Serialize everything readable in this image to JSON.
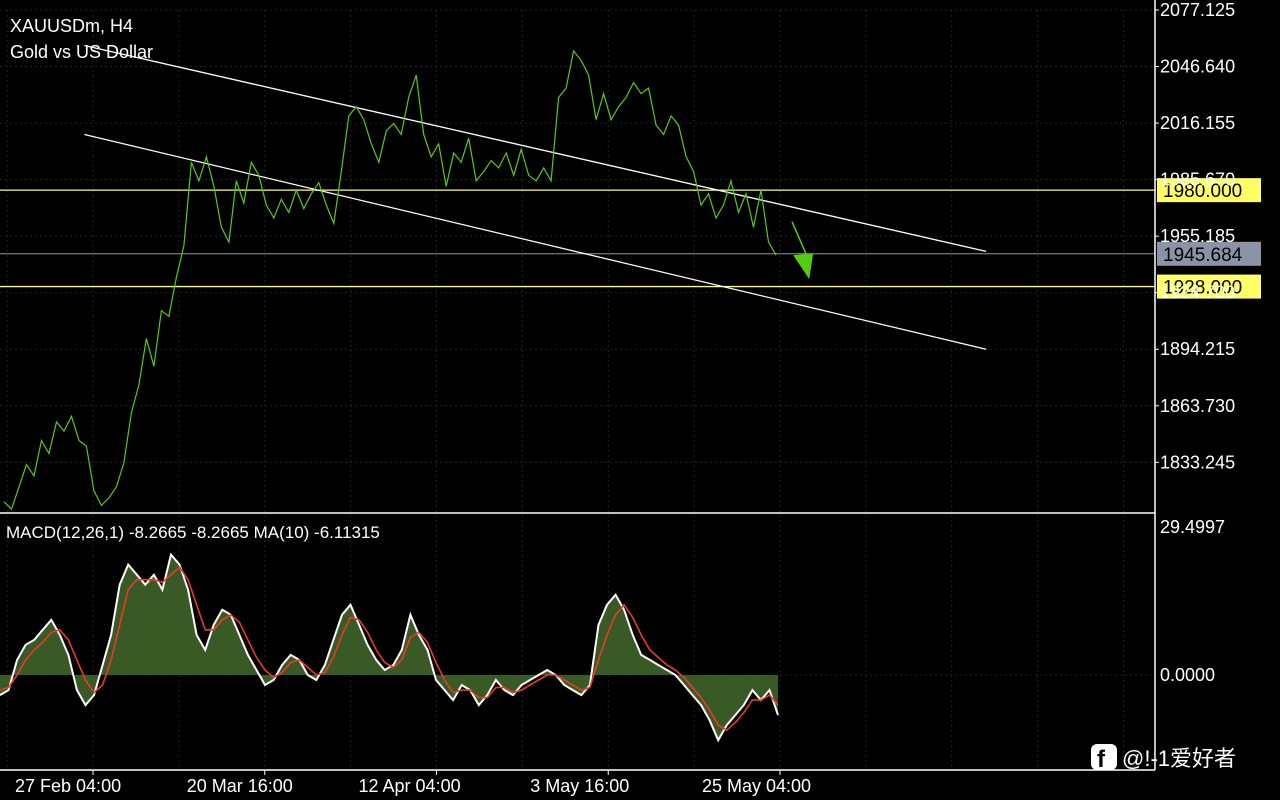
{
  "chart_data": {
    "type": "line",
    "symbol": "XAUUSDm, H4",
    "description": "Gold vs US Dollar",
    "price_axis": {
      "ylim": [
        1807.0,
        2077.125
      ],
      "ticks": [
        "2077.125",
        "2046.640",
        "2016.155",
        "1985.670",
        "1955.185",
        "1924.700",
        "1894.215",
        "1863.730",
        "1833.245"
      ],
      "tick_values": [
        2077.125,
        2046.64,
        2016.155,
        1985.67,
        1955.185,
        1924.7,
        1894.215,
        1863.73,
        1833.245
      ]
    },
    "x_labels": [
      "27 Feb 04:00",
      "20 Mar 16:00",
      "12 Apr 04:00",
      "3 May 16:00",
      "25 May 04:00"
    ],
    "x_label_positions": [
      0,
      1,
      2,
      3,
      4
    ],
    "price_series": [
      1812,
      1808,
      1820,
      1832,
      1826,
      1845,
      1838,
      1855,
      1850,
      1858,
      1845,
      1842,
      1818,
      1810,
      1814,
      1820,
      1833,
      1860,
      1875,
      1900,
      1885,
      1915,
      1912,
      1933,
      1950,
      1995,
      1985,
      1998,
      1982,
      1960,
      1952,
      1985,
      1973,
      1995,
      1988,
      1972,
      1965,
      1975,
      1968,
      1980,
      1970,
      1978,
      1984,
      1972,
      1962,
      1990,
      2020,
      2025,
      2018,
      2005,
      1995,
      2012,
      2016,
      2010,
      2030,
      2042,
      2010,
      1998,
      2005,
      1982,
      2000,
      1995,
      2008,
      1985,
      1990,
      1996,
      1992,
      2000,
      1988,
      2002,
      1988,
      1985,
      1992,
      1985,
      2030,
      2035,
      2055,
      2050,
      2042,
      2018,
      2032,
      2018,
      2025,
      2030,
      2038,
      2032,
      2035,
      2015,
      2010,
      2020,
      2015,
      1998,
      1990,
      1972,
      1978,
      1965,
      1972,
      1985,
      1968,
      1978,
      1960,
      1980,
      1952,
      1945
    ],
    "levels": [
      {
        "value": 1980.0,
        "label": "1980.000",
        "color": "#ffff66"
      },
      {
        "value": 1928.0,
        "label": "1928.000",
        "color": "#ffff66"
      }
    ],
    "current_price": {
      "value": 1945.684,
      "label": "1945.684",
      "color": "#8a94a6"
    },
    "trend_lines": [
      {
        "x0": -0.05,
        "y0": 2058.0,
        "x1": 5.2,
        "y1": 1947.0,
        "color": "#ffffff"
      },
      {
        "x0": -0.05,
        "y0": 2010.0,
        "x1": 5.2,
        "y1": 1894.2,
        "color": "#ffffff"
      }
    ],
    "arrow": {
      "x0": 4.07,
      "y0": 1963.0,
      "x1": 4.17,
      "y1": 1932.0,
      "color": "#55cc11"
    },
    "macd": {
      "label": "MACD(12,26,1) -8.2665 -8.2665 MA(10) -6.11315",
      "ylim": [
        -15.0,
        29.4997
      ],
      "ticks": [
        "29.4997",
        "0.0000"
      ],
      "tick_values": [
        29.4997,
        0.0
      ],
      "values": [
        -4,
        -3,
        3,
        6,
        7,
        9,
        11,
        8,
        4,
        -3,
        -6,
        -4,
        2,
        8,
        18,
        22,
        20,
        18,
        20,
        17,
        24,
        22,
        17,
        8,
        5,
        10,
        13,
        12,
        8,
        4,
        1,
        -2,
        -1,
        2,
        4,
        3,
        0,
        -1,
        2,
        7,
        12,
        14,
        10,
        6,
        3,
        1,
        2,
        5,
        12,
        8,
        5,
        -1,
        -3,
        -5,
        -2,
        -3,
        -6,
        -4,
        -1,
        -3,
        -4,
        -2,
        -1,
        0,
        1,
        0,
        -2,
        -3,
        -4,
        -2,
        10,
        14,
        16,
        13,
        8,
        4,
        3,
        2,
        1,
        0,
        -2,
        -4,
        -6,
        -9,
        -13,
        -10,
        -8,
        -6,
        -3,
        -5,
        -3,
        -8
      ],
      "signal": [
        -3,
        -2.5,
        0,
        3,
        5,
        6.5,
        8.5,
        9,
        7,
        3,
        -1,
        -3.5,
        -2,
        3,
        10,
        17,
        19,
        19,
        19,
        18.5,
        20,
        21.5,
        19,
        14,
        9,
        9,
        11,
        12,
        10.5,
        7,
        3.5,
        1,
        -0.5,
        0.5,
        2.5,
        3,
        1.5,
        0,
        0.5,
        3.5,
        8,
        11.5,
        11,
        8.5,
        5,
        2.5,
        1.5,
        3,
        7.5,
        8.5,
        6.5,
        2.5,
        -1,
        -3.5,
        -3,
        -3,
        -4.5,
        -4.5,
        -2.5,
        -2.5,
        -3.5,
        -3,
        -2,
        -1,
        0,
        0,
        -1,
        -2,
        -3,
        -2.5,
        3,
        8,
        12,
        14,
        11.5,
        8,
        5,
        3.5,
        2,
        1,
        -0.5,
        -2.5,
        -4.5,
        -7,
        -10,
        -11,
        -9.5,
        -7.5,
        -5,
        -5,
        -4,
        -6
      ],
      "colors": {
        "hist": "#3a5a25",
        "main": "#ffffff",
        "signal": "#e83a2a"
      }
    },
    "colors": {
      "price": "#55cc11",
      "grid": "#222222",
      "background": "#000000"
    }
  },
  "watermark": {
    "text": "@!-1爱好者",
    "icon": "facebook-icon"
  }
}
